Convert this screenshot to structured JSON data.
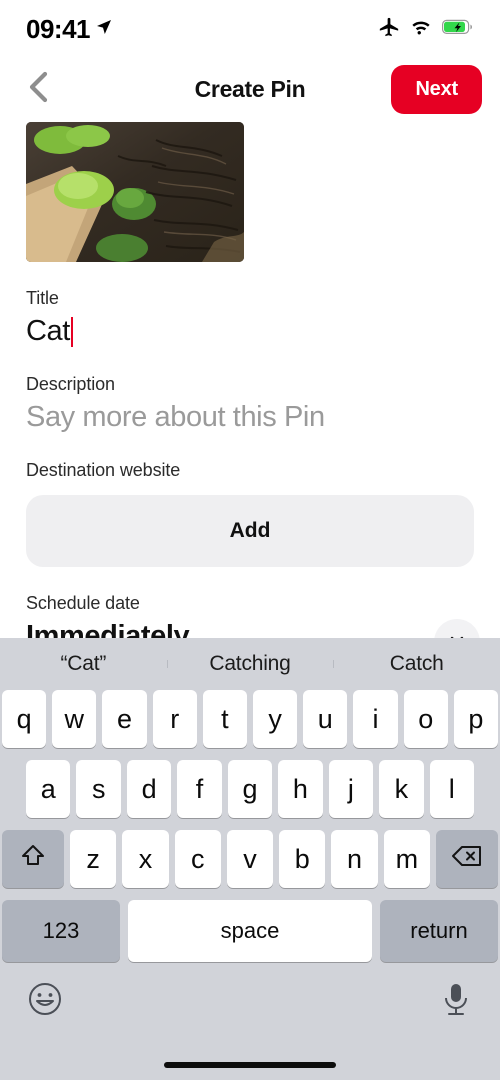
{
  "status_bar": {
    "time": "09:41",
    "icons": [
      "location-arrow-icon",
      "airplane-mode-icon",
      "wifi-icon",
      "battery-charging-icon"
    ]
  },
  "nav": {
    "back_icon": "chevron-left-icon",
    "title": "Create Pin",
    "next_label": "Next",
    "next_color": "#E60023"
  },
  "form": {
    "media": {
      "alt": "pin-image-thumbnail"
    },
    "title": {
      "label": "Title",
      "value": "Cat",
      "caret_color": "#E60023"
    },
    "description": {
      "label": "Description",
      "value": "",
      "placeholder": "Say more about this Pin"
    },
    "destination": {
      "label": "Destination website",
      "add_label": "Add"
    },
    "schedule": {
      "label": "Schedule date",
      "value": "Immediately",
      "toggle_icon": "chevron-icon"
    }
  },
  "keyboard": {
    "predictions": [
      "“Cat”",
      "Catching",
      "Catch"
    ],
    "row1": [
      "q",
      "w",
      "e",
      "r",
      "t",
      "y",
      "u",
      "i",
      "o",
      "p"
    ],
    "row2": [
      "a",
      "s",
      "d",
      "f",
      "g",
      "h",
      "j",
      "k",
      "l"
    ],
    "row3": [
      "z",
      "x",
      "c",
      "v",
      "b",
      "n",
      "m"
    ],
    "shift_icon": "shift-up-arrow-icon",
    "backspace_icon": "backspace-delete-icon",
    "numbers_label": "123",
    "space_label": "space",
    "return_label": "return",
    "emoji_icon": "emoji-smiley-icon",
    "dictation_icon": "microphone-icon"
  }
}
